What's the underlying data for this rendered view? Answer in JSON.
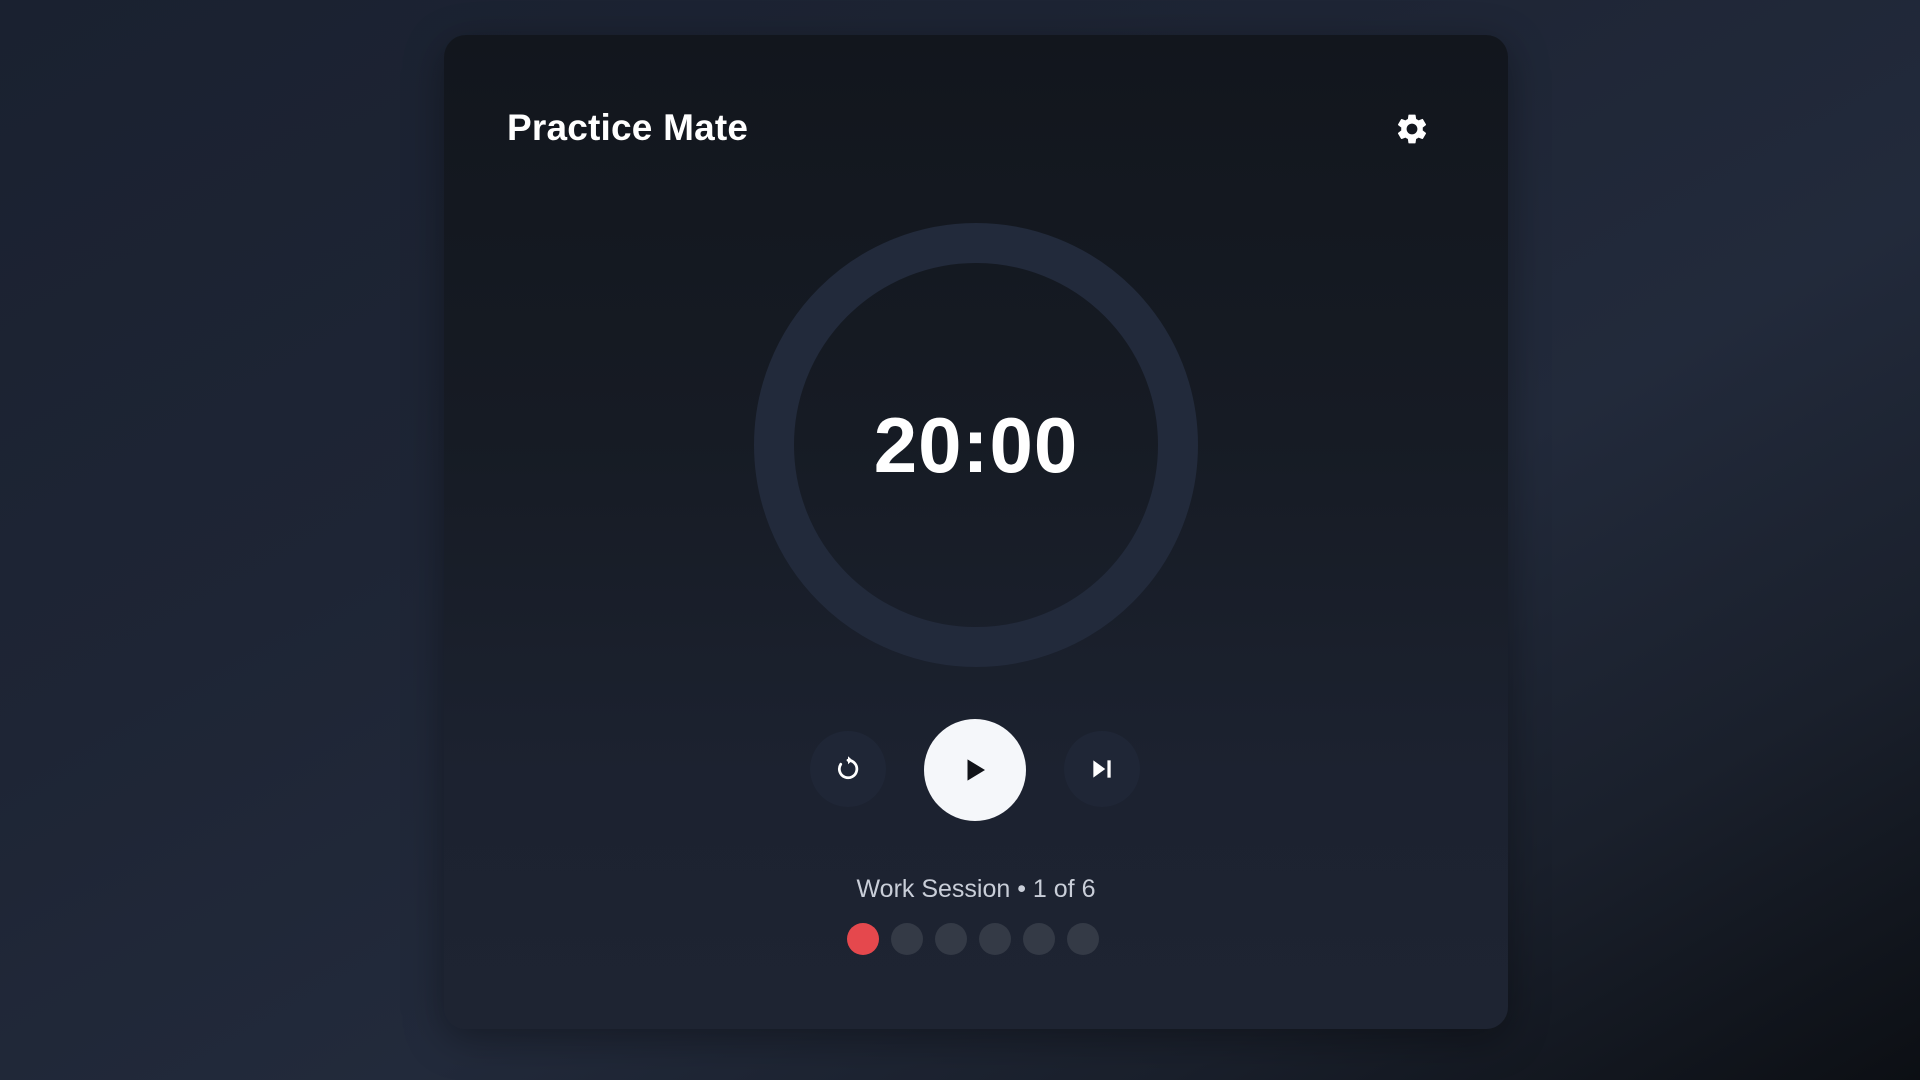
{
  "app": {
    "title": "Practice Mate"
  },
  "timer": {
    "display": "20:00",
    "progress": 0
  },
  "controls": {
    "reset_icon": "reset-icon",
    "play_icon": "play-icon",
    "skip_icon": "skip-next-icon",
    "settings_icon": "gear-icon"
  },
  "session": {
    "label": "Work Session • 1 of 6",
    "current": 1,
    "total": 6
  },
  "colors": {
    "accent": "#e5484d",
    "ring_track": "#222a3b",
    "dot_inactive": "#343a46",
    "play_button": "#f5f7fa"
  }
}
